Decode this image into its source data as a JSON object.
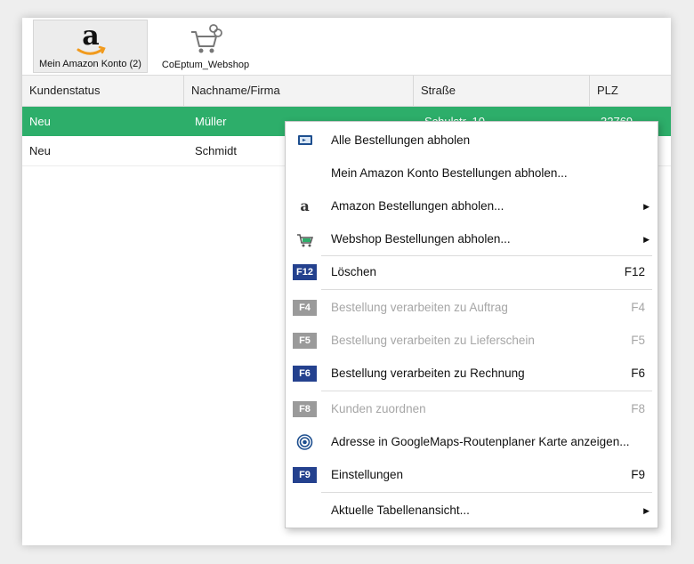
{
  "ribbon": {
    "buttons": [
      {
        "label": "Mein Amazon Konto (2)",
        "icon": "amazon-logo-icon"
      },
      {
        "label": "CoEptum_Webshop",
        "icon": "shopping-cart-icon"
      }
    ]
  },
  "grid": {
    "columns": [
      "Kundenstatus",
      "Nachname/Firma",
      "Straße",
      "PLZ"
    ],
    "rows": [
      {
        "status": "Neu",
        "name": "Müller",
        "street": "Schulstr. 10",
        "plz": "32769"
      },
      {
        "status": "Neu",
        "name": "Schmidt",
        "street": "",
        "plz": ""
      }
    ]
  },
  "context_menu": {
    "items": [
      {
        "label": "Alle Bestellungen abholen",
        "icon": "download-monitor-icon"
      },
      {
        "label": "Mein Amazon Konto Bestellungen abholen..."
      },
      {
        "label": "Amazon Bestellungen abholen...",
        "icon": "amazon-a-icon",
        "submenu": "▶"
      },
      {
        "label": "Webshop Bestellungen abholen...",
        "icon": "cart-icon",
        "submenu": "▶"
      },
      {
        "label": "Löschen",
        "badge": "F12",
        "shortcut": "F12"
      },
      {
        "label": "Bestellung verarbeiten zu Auftrag",
        "badge": "F4",
        "shortcut": "F4",
        "disabled": true
      },
      {
        "label": "Bestellung verarbeiten zu Lieferschein",
        "badge": "F5",
        "shortcut": "F5",
        "disabled": true
      },
      {
        "label": "Bestellung verarbeiten zu Rechnung",
        "badge": "F6",
        "shortcut": "F6"
      },
      {
        "label": "Kunden zuordnen",
        "badge": "F8",
        "shortcut": "F8",
        "disabled": true
      },
      {
        "label": "Adresse in GoogleMaps-Routenplaner Karte anzeigen...",
        "icon": "target-icon"
      },
      {
        "label": "Einstellungen",
        "badge": "F9",
        "shortcut": "F9"
      },
      {
        "label": "Aktuelle Tabellenansicht...",
        "submenu": "▶"
      }
    ]
  },
  "colors": {
    "selected_row": "#2dae6a",
    "fkey_badge": "#24418e",
    "fkey_badge_disabled": "#9a9a9a",
    "amazon_arrow": "#f19a1d"
  }
}
